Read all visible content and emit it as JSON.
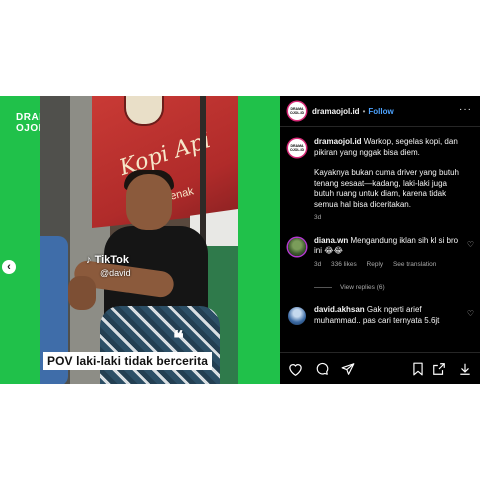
{
  "media": {
    "brand_line1": "DRAMA",
    "brand_line2": "OJOL.ID",
    "banner_text": "Kopi Api",
    "banner_sub": "enak",
    "tiktok_label": "TikTok",
    "tiktok_user": "@david",
    "caption": "POV laki-laki tidak bercerita",
    "quote_mark": "❝",
    "prev_arrow": "‹"
  },
  "header": {
    "avatar_text": "DRAMA OJOL.ID",
    "username": "dramaojol.id",
    "separator": "•",
    "follow_label": "Follow",
    "more_label": "···"
  },
  "caption_comment": {
    "avatar_text": "DRAMA OJOL.ID",
    "username": "dramaojol.id",
    "text1": "Warkop, segelas kopi, dan pikiran yang nggak bisa diem.",
    "text2": "Kayaknya bukan cuma driver yang butuh tenang sesaat—kadang, laki-laki juga butuh ruang untuk diam, karena tidak semua hal bisa diceritakan.",
    "time": "3d"
  },
  "comments": [
    {
      "username": "diana.wn",
      "text": "Mengandung iklan sih kl si bro ini 😂😂",
      "time": "3d",
      "likes": "336 likes",
      "reply": "Reply",
      "see_translation": "See translation",
      "view_replies": "View replies (6)"
    },
    {
      "username": "david.akhsan",
      "text": "Gak ngerti arief muhammad.. pas cari ternyata 5.6jt"
    }
  ],
  "icons": {
    "heart": "heart-icon",
    "comment": "comment-icon",
    "share": "send-icon",
    "bookmark": "bookmark-icon",
    "share_out": "share-icon",
    "download": "download-icon"
  },
  "colors": {
    "brand_green": "#20c14a",
    "panel_bg": "#000000",
    "follow_blue": "#4da3ff"
  }
}
